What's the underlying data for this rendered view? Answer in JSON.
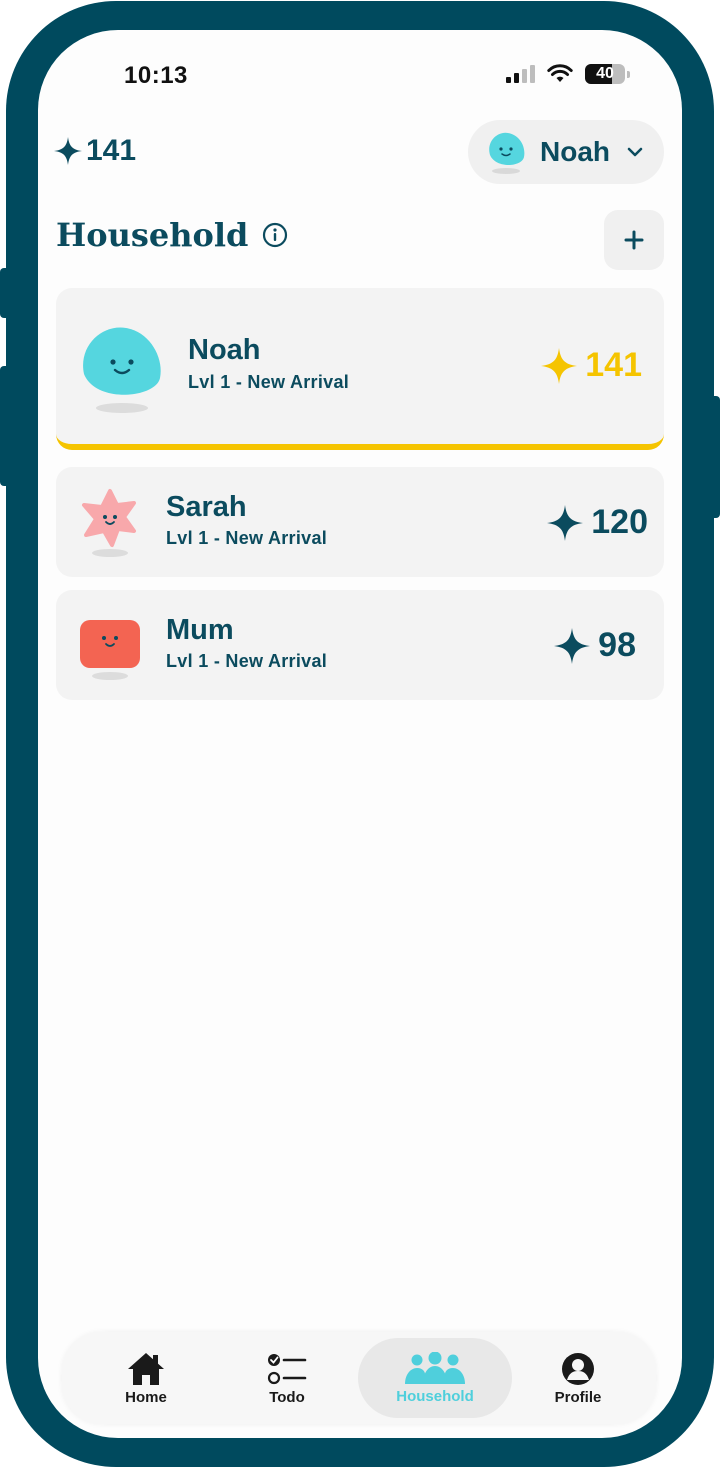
{
  "status_bar": {
    "time": "10:13",
    "battery_level": "40"
  },
  "header": {
    "points": "141",
    "user_name": "Noah"
  },
  "section": {
    "title": "Household"
  },
  "members": [
    {
      "name": "Noah",
      "level": "Lvl 1 - New Arrival",
      "points": "141",
      "active": true,
      "avatar": "teal-blob",
      "color": "#55d6df"
    },
    {
      "name": "Sarah",
      "level": "Lvl 1 - New Arrival",
      "points": "120",
      "active": false,
      "avatar": "pink-star",
      "color": "#f8a8ab"
    },
    {
      "name": "Mum",
      "level": "Lvl 1 - New Arrival",
      "points": "98",
      "active": false,
      "avatar": "red-square",
      "color": "#f36452"
    }
  ],
  "nav": {
    "items": [
      {
        "label": "Home",
        "icon": "home-icon"
      },
      {
        "label": "Todo",
        "icon": "todo-icon"
      },
      {
        "label": "Household",
        "icon": "household-icon",
        "active": true
      },
      {
        "label": "Profile",
        "icon": "profile-icon"
      }
    ]
  },
  "colors": {
    "frame": "#004a5e",
    "text": "#0b4b5e",
    "highlight": "#f5c400",
    "accent": "#4fcfdc",
    "card": "#f3f3f3"
  }
}
